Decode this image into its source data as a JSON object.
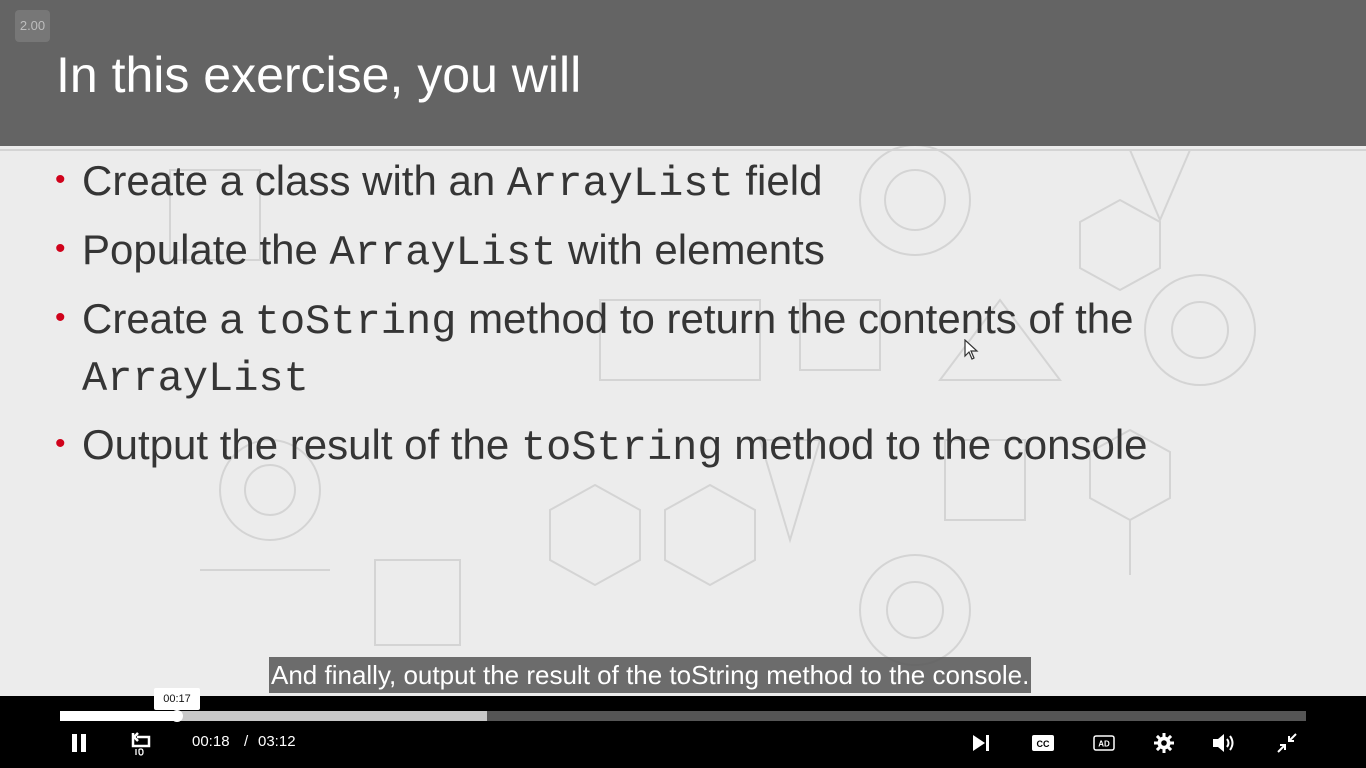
{
  "slide": {
    "speed_badge": "2.00",
    "title": "In this exercise, you will",
    "bullets": [
      {
        "pre": "Create a class with an ",
        "code": "ArrayList",
        "post": " field"
      },
      {
        "pre": "Populate the ",
        "code": "ArrayList",
        "post": " with elements"
      },
      {
        "pre": "Create a ",
        "code": "toString",
        "post": " method to return the contents of the",
        "code2": "ArrayList"
      },
      {
        "pre": "Output the result of the ",
        "code": "toString",
        "post": " method to the console"
      }
    ]
  },
  "caption": "And finally, output the result of the toString method to the console.",
  "player": {
    "seek_tooltip": "00:17",
    "current_time": "00:18",
    "separator": "/",
    "duration": "03:12",
    "progress_fraction": 0.094,
    "buffered_fraction": 0.343
  },
  "icons": {
    "play_pause": "pause-icon",
    "rewind": "rewind-10-icon",
    "next": "skip-next-icon",
    "captions": "closed-captions-icon",
    "audio_description": "audio-description-icon",
    "settings": "gear-icon",
    "volume": "volume-icon",
    "fullscreen": "exit-fullscreen-icon"
  },
  "colors": {
    "header_bg": "#646464",
    "bullet_dot": "#d0021b",
    "slide_text": "#353535"
  }
}
